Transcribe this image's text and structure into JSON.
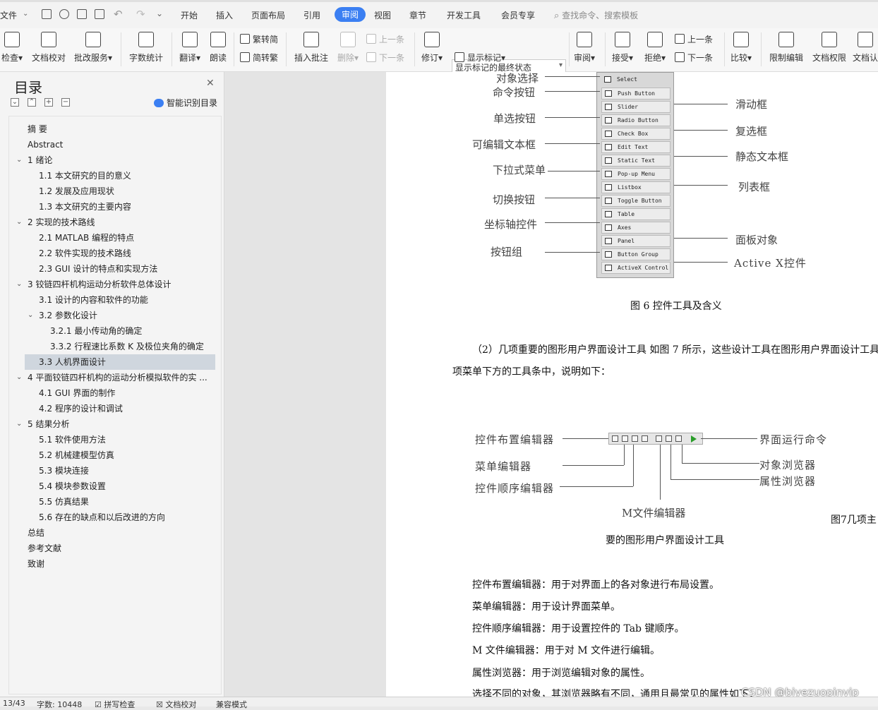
{
  "menubar": {
    "file": "文件",
    "items": [
      "开始",
      "插入",
      "页面布局",
      "引用",
      "审阅",
      "视图",
      "章节",
      "开发工具",
      "会员专享"
    ],
    "active_index": 4,
    "search_placeholder": "查找命令、搜索模板"
  },
  "ribbon": {
    "spell_check": "检查",
    "doc_check": "文档校对",
    "review_service": "批改服务",
    "word_count": "字数统计",
    "translate": "翻译",
    "read_aloud": "朗读",
    "trad_simp": "繁转简",
    "simp_trad": "简转繁",
    "insert_comment": "插入批注",
    "delete": "删除",
    "prev_comment": "上一条",
    "next_comment": "下一条",
    "revise": "修订",
    "markup_select": "显示标记的最终状态",
    "show_markup": "显示标记",
    "review_pane": "审阅",
    "accept": "接受",
    "reject": "拒绝",
    "prev_change": "上一条",
    "next_change": "下一条",
    "compare": "比较",
    "restrict_edit": "限制编辑",
    "doc_permission": "文档权限",
    "doc_verify": "文档认"
  },
  "toc": {
    "title": "目录",
    "smart_label": "智能识别目录",
    "items": [
      {
        "label": "摘  要"
      },
      {
        "label": "Abstract"
      },
      {
        "label": "1  绪论"
      },
      {
        "label": "1.1  本文研究的目的意义"
      },
      {
        "label": "1.2  发展及应用现状"
      },
      {
        "label": "1.3  本文研究的主要内容"
      },
      {
        "label": "2  实现的技术路线"
      },
      {
        "label": "2.1 MATLAB 编程的特点"
      },
      {
        "label": "2.2  软件实现的技术路线"
      },
      {
        "label": "2.3 GUI 设计的特点和实现方法"
      },
      {
        "label": "3  铰链四杆机构运动分析软件总体设计"
      },
      {
        "label": "3.1  设计的内容和软件的功能"
      },
      {
        "label": "3.2  参数化设计"
      },
      {
        "label": "3.2.1  最小传动角的确定"
      },
      {
        "label": "3.3.2  行程速比系数 K 及极位夹角的确定"
      },
      {
        "label": "3.3  人机界面设计"
      },
      {
        "label": "4  平面铰链四杆机构的运动分析模拟软件的实 ..."
      },
      {
        "label": "4.1 GUI 界面的制作"
      },
      {
        "label": "4.2  程序的设计和调试"
      },
      {
        "label": "5  结果分析"
      },
      {
        "label": "5.1  软件使用方法"
      },
      {
        "label": "5.2  机械建模型仿真"
      },
      {
        "label": "5.3  模块连接"
      },
      {
        "label": "5.4  模块参数设置"
      },
      {
        "label": "5.5  仿真结果"
      },
      {
        "label": "5.6  存在的缺点和以后改进的方向"
      },
      {
        "label": "总结"
      },
      {
        "label": "参考文献"
      },
      {
        "label": "致谢"
      }
    ]
  },
  "doc": {
    "fig6": {
      "left_labels": [
        "对象选择",
        "命令按钮",
        "单选按钮",
        "可编辑文本框",
        "下拉式菜单",
        "切换按钮",
        "坐标轴控件",
        "按钮组"
      ],
      "right_labels": [
        "滑动框",
        "复选框",
        "静态文本框",
        "列表框",
        "面板对象",
        "Active  X控件"
      ],
      "palette": [
        "Select",
        "Push Button",
        "Slider",
        "Radio Button",
        "Check Box",
        "Edit Text",
        "Static Text",
        "Pop-up Menu",
        "Listbox",
        "Toggle Button",
        "Table",
        "Axes",
        "Panel",
        "Button Group",
        "ActiveX Control"
      ],
      "caption": "图 6 控件工具及含义"
    },
    "para1_line1": "（2）几项重要的图形用户界面设计工具    如图 7 所示，这些设计工具在图形用户界面设计工具",
    "para1_line2": "项菜单下方的工具条中，说明如下：",
    "fig7": {
      "left_labels": [
        "控件布置编辑器",
        "菜单编辑器",
        "控件顺序编辑器"
      ],
      "bottom_label": "M文件编辑器",
      "right_labels": [
        "界面运行命令",
        "对象浏览器",
        "属性浏览器"
      ],
      "caption_right": "图7几项主",
      "caption_line2": "要的图形用户界面设计工具"
    },
    "list": [
      "控件布置编辑器：用于对界面上的各对象进行布局设置。",
      "菜单编辑器：用于设计界面菜单。",
      "控件顺序编辑器：用于设置控件的 Tab 键顺序。",
      "M 文件编辑器：用于对 M 文件进行编辑。",
      "属性浏览器：用于浏览编辑对象的属性。",
      "选择不同的对象，其浏览器略有不同，通用且最常见的属性如下："
    ]
  },
  "status": {
    "page": "13/43",
    "word_count": "字数: 10448",
    "spell": "拼写检查",
    "doc_check": "文档校对",
    "compat": "兼容模式"
  },
  "watermark": "CSDN @biyezuopinvip"
}
